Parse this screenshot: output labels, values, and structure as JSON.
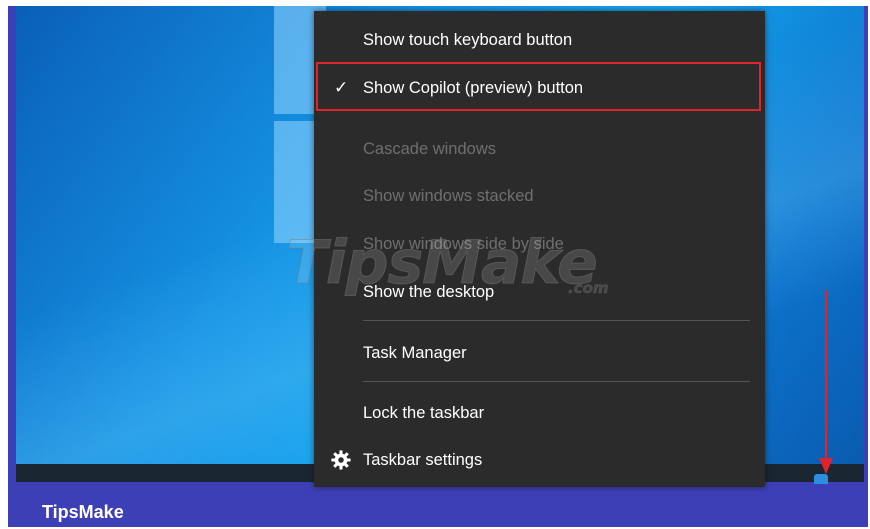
{
  "menu": {
    "items": [
      {
        "label": "Show touch keyboard button",
        "enabled": true
      },
      {
        "label": "Show Copilot (preview) button",
        "enabled": true,
        "checked": true,
        "highlighted": true
      },
      {
        "label": "Cascade windows",
        "enabled": false
      },
      {
        "label": "Show windows stacked",
        "enabled": false
      },
      {
        "label": "Show windows side by side",
        "enabled": false
      },
      {
        "label": "Show the desktop",
        "enabled": true
      },
      {
        "label": "Task Manager",
        "enabled": true
      },
      {
        "label": "Lock the taskbar",
        "enabled": true
      },
      {
        "label": "Taskbar settings",
        "enabled": true,
        "icon": "gear-icon"
      }
    ],
    "check_glyph": "✓"
  },
  "watermark": {
    "text": "TipsMake",
    "suffix": ".com"
  },
  "footer": {
    "brand": "TipsMake"
  },
  "colors": {
    "menu_bg": "#2b2b2b",
    "highlight_border": "#e0242c",
    "footer_bar": "#3d3fb6",
    "desktop_blue": "#1592e3",
    "arrow": "#e0242c"
  },
  "annotation": {
    "arrow_icon": "arrow-down-icon"
  }
}
